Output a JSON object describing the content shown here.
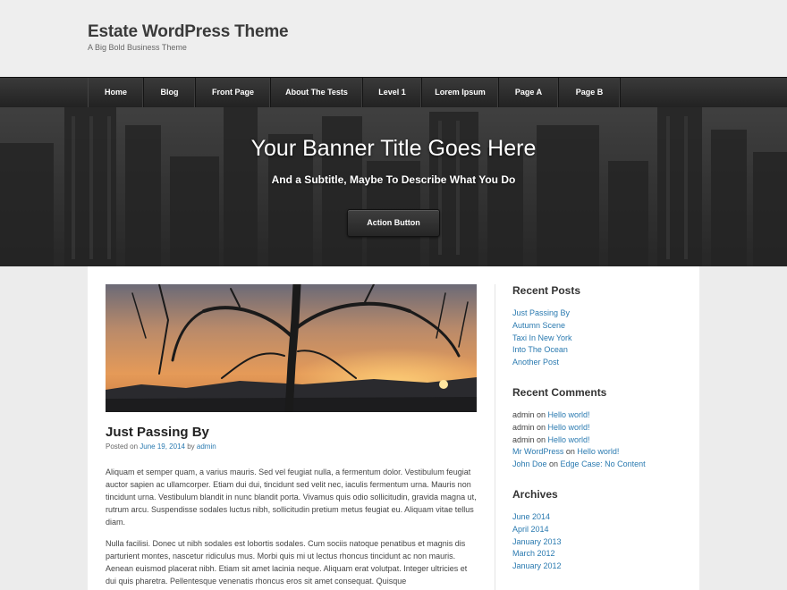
{
  "site": {
    "title": "Estate WordPress Theme",
    "description": "A Big Bold Business Theme"
  },
  "nav": {
    "items": [
      "Home",
      "Blog",
      "Front Page",
      "About The Tests",
      "Level 1",
      "Lorem Ipsum",
      "Page A",
      "Page B"
    ]
  },
  "banner": {
    "title": "Your Banner Title Goes Here",
    "subtitle": "And a Subtitle, Maybe To Describe What You Do",
    "button_label": "Action Button"
  },
  "post": {
    "title": "Just Passing By",
    "meta_prefix": "Posted on ",
    "date": "June 19, 2014",
    "meta_by": " by ",
    "author": "admin",
    "paragraphs": [
      "Aliquam et semper quam, a varius mauris. Sed vel feugiat nulla, a fermentum dolor. Vestibulum feugiat auctor sapien ac ullamcorper. Etiam dui dui, tincidunt sed velit nec, iaculis fermentum urna. Mauris non tincidunt urna. Vestibulum blandit in nunc blandit porta. Vivamus quis odio sollicitudin, gravida magna ut, rutrum arcu. Suspendisse sodales luctus nibh, sollicitudin pretium metus feugiat eu. Aliquam vitae tellus diam.",
      "Nulla facilisi. Donec ut nibh sodales est lobortis sodales. Cum sociis natoque penatibus et magnis dis parturient montes, nascetur ridiculus mus. Morbi quis mi ut lectus rhoncus tincidunt ac non mauris. Aenean euismod placerat nibh. Etiam sit amet lacinia neque. Aliquam erat volutpat. Integer ultricies et dui quis pharetra. Pellentesque venenatis rhoncus eros sit amet consequat. Quisque"
    ]
  },
  "sidebar": {
    "recent_posts": {
      "title": "Recent Posts",
      "items": [
        "Just Passing By",
        "Autumn Scene",
        "Taxi In New York",
        "Into The Ocean",
        "Another Post"
      ]
    },
    "recent_comments": {
      "title": "Recent Comments",
      "items": [
        {
          "author": "admin",
          "on": " on ",
          "post": "Hello world!",
          "author_link": false
        },
        {
          "author": "admin",
          "on": " on ",
          "post": "Hello world!",
          "author_link": false
        },
        {
          "author": "admin",
          "on": " on ",
          "post": "Hello world!",
          "author_link": false
        },
        {
          "author": "Mr WordPress",
          "on": " on ",
          "post": "Hello world!",
          "author_link": true
        },
        {
          "author": "John Doe",
          "on": " on ",
          "post": "Edge Case: No Content",
          "author_link": true
        }
      ]
    },
    "archives": {
      "title": "Archives",
      "items": [
        "June 2014",
        "April 2014",
        "January 2013",
        "March 2012",
        "January 2012"
      ]
    }
  },
  "colors": {
    "link": "#2a7ab0",
    "nav_bg": "#2a2a2a",
    "page_bg": "#ececec"
  }
}
